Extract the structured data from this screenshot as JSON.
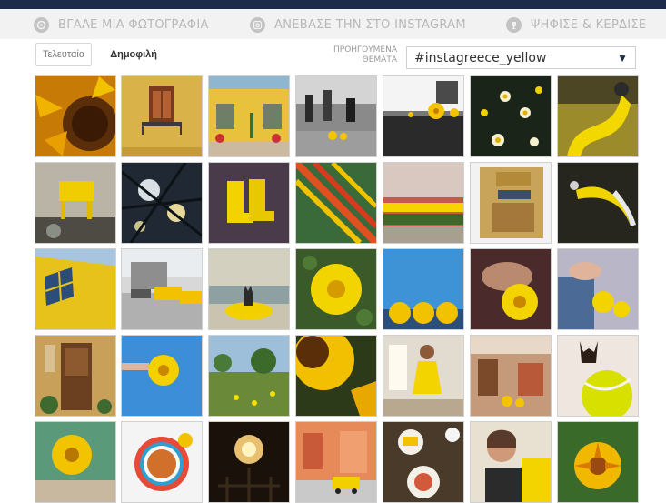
{
  "nav": {
    "items": [
      {
        "label": "ΒΓΑΛΕ ΜΙΑ ΦΩΤΟΓΡΑΦΙΑ",
        "icon": "camera-shutter-icon"
      },
      {
        "label": "ΑΝΕΒΑΣΕ ΤΗΝ ΣΤΟ INSTAGRAM",
        "icon": "instagram-icon"
      },
      {
        "label": "ΨΗΦΙΣΕ & ΚΕΡΔΙΣΕ",
        "icon": "trophy-icon"
      }
    ]
  },
  "tabs": {
    "latest": "Τελευταία",
    "popular": "Δημοφιλή"
  },
  "previous_topics": {
    "line1": "ΠΡΟΗΓΟΥΜΕΝΑ",
    "line2": "ΘΕΜΑΤΑ"
  },
  "topic_select": {
    "value": "#instagreece_yellow"
  },
  "colors": {
    "navbar": "#f2f2f2",
    "topbar": "#1c2b4a",
    "nav_text": "#b8b8b8",
    "accent_yellow": "#f2c200"
  },
  "photos": [
    {
      "subject": "sunflower-closeup"
    },
    {
      "subject": "yellow-house-balcony"
    },
    {
      "subject": "yellow-house-plants"
    },
    {
      "subject": "street-flower-market"
    },
    {
      "subject": "tram-flowers"
    },
    {
      "subject": "yellow-daisies"
    },
    {
      "subject": "yellow-sculpture"
    },
    {
      "subject": "yellow-chair"
    },
    {
      "subject": "tree-branches-sky"
    },
    {
      "subject": "yellow-boots"
    },
    {
      "subject": "yellow-railing"
    },
    {
      "subject": "yellow-bench"
    },
    {
      "subject": "gold-statue"
    },
    {
      "subject": "banana"
    },
    {
      "subject": "yellow-wall-window"
    },
    {
      "subject": "taxi-street"
    },
    {
      "subject": "cat-yellow-buoy"
    },
    {
      "subject": "yellow-daisy"
    },
    {
      "subject": "lemons-sky"
    },
    {
      "subject": "daisy-hand"
    },
    {
      "subject": "yellow-flower-hand"
    },
    {
      "subject": "yellow-door"
    },
    {
      "subject": "flower-blue-sky"
    },
    {
      "subject": "field-flowers"
    },
    {
      "subject": "sunflower"
    },
    {
      "subject": "child-yellow-dress"
    },
    {
      "subject": "market-street"
    },
    {
      "subject": "dog-tennis-ball"
    },
    {
      "subject": "yellow-gerbera"
    },
    {
      "subject": "tea-cup-palette"
    },
    {
      "subject": "night-sign"
    },
    {
      "subject": "yellow-car-street"
    },
    {
      "subject": "food-table"
    },
    {
      "subject": "smiling-woman"
    },
    {
      "subject": "yellow-gazania"
    }
  ]
}
